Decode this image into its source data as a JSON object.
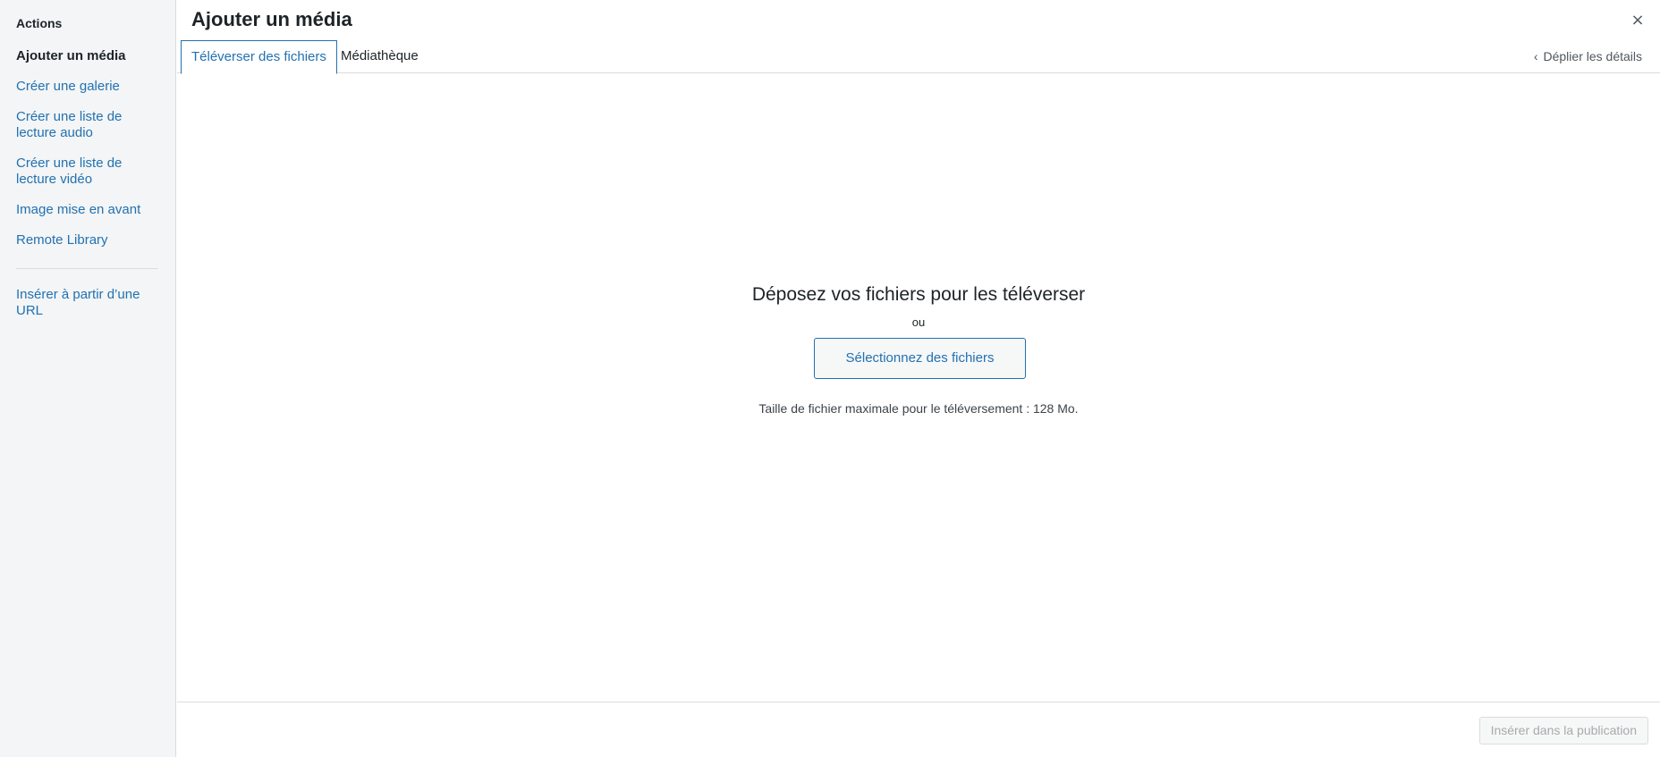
{
  "modal": {
    "title": "Ajouter un média",
    "close_icon": "×"
  },
  "sidebar": {
    "heading": "Actions",
    "items": [
      {
        "label": "Ajouter un média",
        "active": true
      },
      {
        "label": "Créer une galerie"
      },
      {
        "label": "Créer une liste de lecture audio"
      },
      {
        "label": "Créer une liste de lecture vidéo"
      },
      {
        "label": "Image mise en avant"
      },
      {
        "label": "Remote Library"
      }
    ],
    "extra_items": [
      {
        "label": "Insérer à partir d’une URL"
      }
    ]
  },
  "tabs": [
    {
      "label": "Téléverser des fichiers",
      "active": true
    },
    {
      "label": "Médiathèque"
    }
  ],
  "expand_details": {
    "label": "Déplier les détails",
    "icon": "chevron-left-icon"
  },
  "uploader": {
    "drop_title": "Déposez vos fichiers pour les téléverser",
    "or_text": "ou",
    "select_button": "Sélectionnez des fichiers",
    "max_size_text": "Taille de fichier maximale pour le téléversement : 128 Mo."
  },
  "footer": {
    "insert_button": "Insérer dans la publication"
  },
  "colors": {
    "accent": "#2271b1",
    "sidebar_bg": "#f3f5f6",
    "border": "#dcdcde",
    "disabled_text": "#a7aaad"
  }
}
